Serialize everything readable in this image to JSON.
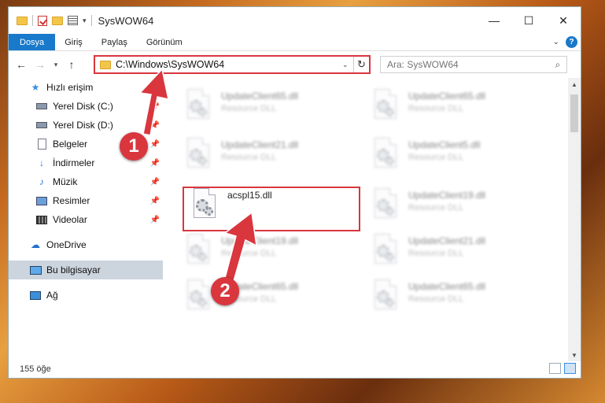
{
  "window": {
    "title": "SysWOW64",
    "minimize": "—",
    "maximize": "☐",
    "close": "✕"
  },
  "ribbon": {
    "tabs": [
      "Dosya",
      "Giriş",
      "Paylaş",
      "Görünüm"
    ]
  },
  "nav": {
    "back": "←",
    "forward": "→",
    "recent": "▾",
    "up": "↑"
  },
  "address": {
    "path": "C:\\Windows\\SysWOW64"
  },
  "search": {
    "placeholder": "Ara: SysWOW64"
  },
  "sidebar": {
    "items": [
      {
        "label": "Hızlı erişim"
      },
      {
        "label": "Yerel Disk (C:)"
      },
      {
        "label": "Yerel Disk (D:)"
      },
      {
        "label": "Belgeler"
      },
      {
        "label": "İndirmeler"
      },
      {
        "label": "Müzik"
      },
      {
        "label": "Resimler"
      },
      {
        "label": "Videolar"
      },
      {
        "label": "OneDrive"
      },
      {
        "label": "Bu bilgisayar"
      },
      {
        "label": "Ağ"
      }
    ]
  },
  "files": [
    {
      "name": "UpdateClient65.dll",
      "type": "Resource DLL"
    },
    {
      "name": "UpdateClient65.dll",
      "type": "Resource DLL"
    },
    {
      "name": "UpdateClient21.dll",
      "type": "Resource DLL"
    },
    {
      "name": "UpdateClient5.dll",
      "type": "Resource DLL"
    },
    {
      "name": "acspl15.dll",
      "type": ""
    },
    {
      "name": "UpdateClient19.dll",
      "type": "Resource DLL"
    },
    {
      "name": "UpdateClient19.dll",
      "type": "Resource DLL"
    },
    {
      "name": "UpdateClient21.dll",
      "type": "Resource DLL"
    },
    {
      "name": "UpdateClient65.dll",
      "type": "Resource DLL"
    },
    {
      "name": "UpdateClient65.dll",
      "type": "Resource DLL"
    }
  ],
  "status": {
    "count": "155 öğe"
  },
  "annotations": {
    "badge1": "1",
    "badge2": "2",
    "color": "#d9363e"
  }
}
